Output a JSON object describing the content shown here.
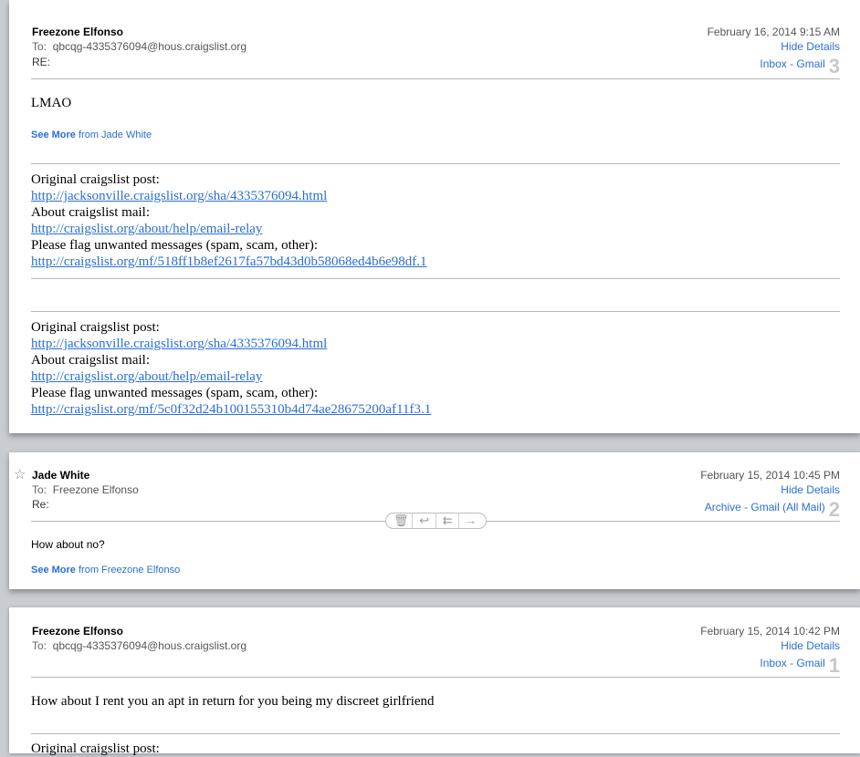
{
  "messages": [
    {
      "from": "Freezone Elfonso",
      "to_label": "To:",
      "to": "qbcqg-4335376094@hous.craigslist.org",
      "re_label": "RE:",
      "date": "February 16, 2014  9:15 AM",
      "hide_details": "Hide Details",
      "mailbox": "Inbox - Gmail",
      "number": "3",
      "body": "LMAO",
      "see_more_bold": "See More",
      "see_more_rest": "from Jade White",
      "footers": [
        {
          "orig_label": "Original craigslist post:",
          "orig_link": "http://jacksonville.craigslist.org/sha/4335376094.html",
          "about_label": "About craigslist mail:",
          "about_link": "http://craigslist.org/about/help/email-relay",
          "flag_label": "Please flag unwanted messages (spam, scam, other):",
          "flag_link": "http://craigslist.org/mf/518ff1b8ef2617fa57bd43d0b58068ed4b6e98df.1"
        },
        {
          "orig_label": "Original craigslist post:",
          "orig_link": "http://jacksonville.craigslist.org/sha/4335376094.html",
          "about_label": "About craigslist mail:",
          "about_link": "http://craigslist.org/about/help/email-relay",
          "flag_label": "Please flag unwanted messages (spam, scam, other):",
          "flag_link": "http://craigslist.org/mf/5c0f32d24b100155310b4d74ae28675200af11f3.1"
        }
      ]
    },
    {
      "from": "Jade White",
      "to_label": "To:",
      "to": "Freezone Elfonso",
      "re_label": "Re:",
      "date": "February 15, 2014  10:45 PM",
      "hide_details": "Hide Details",
      "mailbox": "Archive - Gmail (All Mail)",
      "number": "2",
      "body": "How about no?",
      "see_more_bold": "See More",
      "see_more_rest": "from Freezone Elfonso",
      "toolbar": [
        "trash-icon",
        "reply-icon",
        "reply-all-icon",
        "forward-icon"
      ]
    },
    {
      "from": "Freezone Elfonso",
      "to_label": "To:",
      "to": "qbcqg-4335376094@hous.craigslist.org",
      "date": "February 15, 2014  10:42 PM",
      "hide_details": "Hide Details",
      "mailbox": "Inbox - Gmail",
      "number": "1",
      "body": "How about I rent you an apt in return for you being my discreet girlfriend",
      "footer_partial": "Original craigslist post:"
    }
  ],
  "colors": {
    "link": "#2a6fd6",
    "background": "#c9ccd1"
  }
}
